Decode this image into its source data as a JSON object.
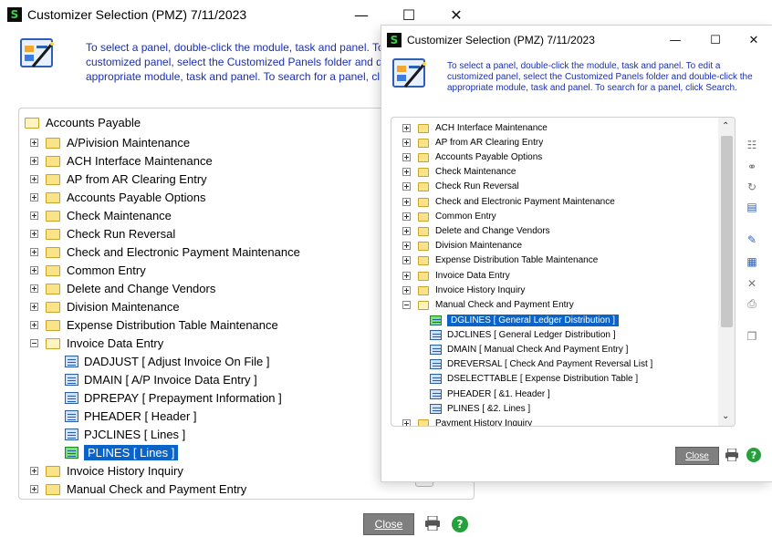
{
  "back_window": {
    "title": "Customizer Selection (PMZ) 7/11/2023",
    "controls": {
      "minimize": "—",
      "maximize": "☐",
      "close": "✕"
    },
    "banner_lines": [
      "To select a panel, double-click the module, task and panel. To",
      "customized panel, select the Customized Panels folder and d",
      "appropriate module, task and panel. To search for a panel, cl"
    ],
    "root": "Accounts Payable",
    "folders_top": [
      "A/Pivision Maintenance",
      "ACH Interface Maintenance",
      "AP from AR Clearing Entry",
      "Accounts Payable Options",
      "Check Maintenance",
      "Check Run Reversal",
      "Check and Electronic Payment Maintenance",
      "Common Entry",
      "Delete and Change Vendors",
      "Division Maintenance",
      "Expense Distribution Table Maintenance"
    ],
    "open_folder": "Invoice Data Entry",
    "panels": [
      "DADJUST  [ Adjust Invoice On File ]",
      "DMAIN  [ A/P Invoice Data Entry ]",
      "DPREPAY  [ Prepayment Information ]",
      "PHEADER  [ Header ]",
      "PJCLINES  [ Lines ]",
      "PLINES  [ Lines ]"
    ],
    "folders_bottom": [
      "Invoice History Inquiry",
      "Manual Check and Payment Entry"
    ],
    "close_label": "Close"
  },
  "front_window": {
    "title": "Customizer Selection (PMZ) 7/11/2023",
    "controls": {
      "minimize": "—",
      "maximize": "☐",
      "close": "✕"
    },
    "banner_lines": [
      "To select a panel, double-click the module, task and panel. To edit a",
      "customized panel, select the Customized Panels folder and double-click the",
      "appropriate module, task and panel. To search for a panel, click Search."
    ],
    "folders_top": [
      "ACH Interface Maintenance",
      "AP from AR Clearing Entry",
      "Accounts Payable Options",
      "Check Maintenance",
      "Check Run Reversal",
      "Check and Electronic Payment Maintenance",
      "Common Entry",
      "Delete and Change Vendors",
      "Division Maintenance",
      "Expense Distribution Table Maintenance",
      "Invoice Data Entry",
      "Invoice History Inquiry"
    ],
    "open_folder": "Manual Check and Payment Entry",
    "panels": [
      "DGLINES  [ General Ledger Distribution ]",
      "DJCLINES  [ General Ledger Distribution ]",
      "DMAIN  [ Manual Check And Payment Entry ]",
      "DREVERSAL  [ Check And Payment Reversal List ]",
      "DSELECTTABLE  [ Expense Distribution Table ]",
      "PHEADER  [ &1. Header ]",
      "PLINES  [ &2. Lines ]"
    ],
    "folders_bottom": [
      "Payment History Inquiry"
    ],
    "close_label": "Close",
    "side_icons": [
      "tree-icon",
      "binoculars-icon",
      "refresh-icon",
      "panel-icon",
      "edit-icon",
      "preview-icon",
      "delete-icon",
      "print-icon",
      "copy-icon"
    ]
  }
}
